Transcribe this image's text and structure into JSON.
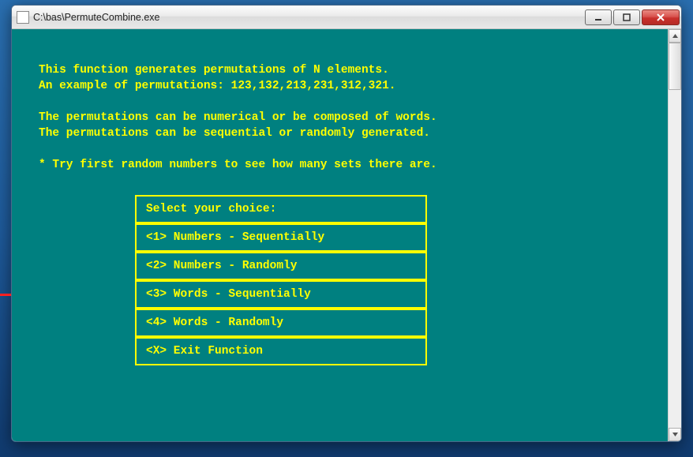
{
  "window": {
    "title": "C:\\bas\\PermuteCombine.exe"
  },
  "console": {
    "line1": "This function generates permutations of N elements.",
    "line2": "An example of permutations: 123,132,213,231,312,321.",
    "line3": "The permutations can be numerical or be composed of words.",
    "line4": "The permutations can be sequential or randomly generated.",
    "tip": "* Try first random numbers to see how many sets there are."
  },
  "menu": {
    "header": "Select your choice:",
    "items": [
      {
        "label": "<1> Numbers - Sequentially"
      },
      {
        "label": "<2> Numbers - Randomly"
      },
      {
        "label": "<3> Words - Sequentially"
      },
      {
        "label": "<4> Words - Randomly"
      },
      {
        "label": "<X> Exit Function"
      }
    ]
  }
}
